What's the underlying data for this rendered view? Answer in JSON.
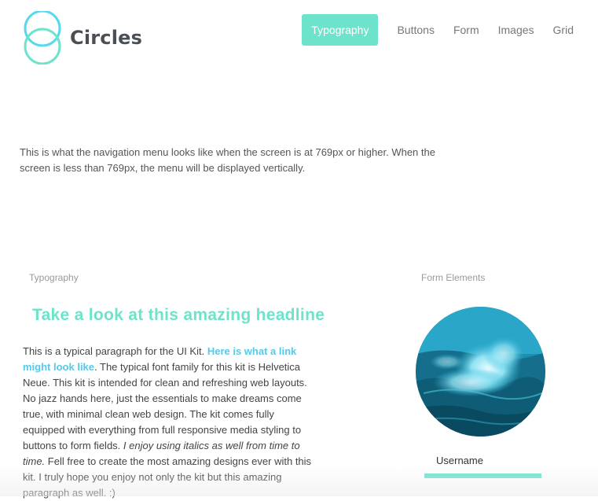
{
  "brand": {
    "name": "Circles",
    "color": "#56d9ea"
  },
  "nav": {
    "items": [
      {
        "label": "Typography",
        "active": true
      },
      {
        "label": "Buttons",
        "active": false
      },
      {
        "label": "Form",
        "active": false
      },
      {
        "label": "Images",
        "active": false
      },
      {
        "label": "Grid",
        "active": false
      }
    ]
  },
  "intro": {
    "text": "This is what the navigation menu looks like when the screen is at 769px or higher. When the screen is less than 769px, the menu will be displayed vertically."
  },
  "typography": {
    "section_label": "Typography",
    "headline": "Take a look at this amazing headline",
    "paragraph": {
      "part1": "This is a typical paragraph for the UI Kit. ",
      "link": "Here is what a link might look like",
      "part2": ". The typical font family for this kit is Helvetica Neue. This kit is intended for clean and refreshing web layouts. No jazz hands here, just the essentials to make dreams come true, with minimal clean web design. The kit comes fully equipped with everything from full responsive media styling to buttons to form fields. ",
      "italic": "I enjoy using italics as well from time to time.",
      "part3": " Fell free to create the most amazing designs ever with this kit. I truly hope you enjoy not only the kit but this amazing paragraph as well. :)"
    }
  },
  "form_elements": {
    "section_label": "Form Elements",
    "username_label": "Username",
    "username_value": ""
  },
  "colors": {
    "accent": "#6ee3cb",
    "link": "#55c9ea"
  }
}
